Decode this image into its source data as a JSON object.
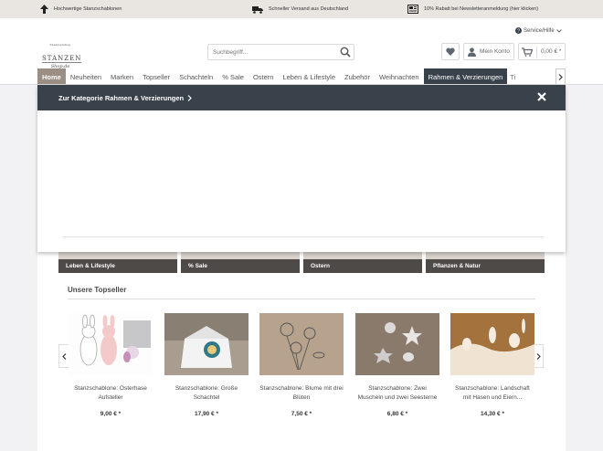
{
  "usp": [
    {
      "icon": "arrow-up-icon",
      "text": "Hochwertige Stanzschablonen"
    },
    {
      "icon": "truck-icon",
      "text": "Schneller Versand aus Deutschland"
    },
    {
      "icon": "newsletter-icon",
      "text": "10% Rabatt bei Newsletteranmeldung (hier klicken)"
    }
  ],
  "logo": {
    "line1": "Stempelshop",
    "line2": "STANZEN",
    "line3": "Shop.de"
  },
  "service": {
    "label": "Service/Hilfe"
  },
  "search": {
    "placeholder": "Suchbegriff..."
  },
  "account": {
    "label": "Mein Konto"
  },
  "cart": {
    "amount": "0,00 € *"
  },
  "nav": {
    "items": [
      "Home",
      "Neuheiten",
      "Marken",
      "Topseller",
      "Schachteln",
      "% Sale",
      "Ostern",
      "Leben & Lifestyle",
      "Zubehör",
      "Weihnachten",
      "Rahmen & Verzierungen",
      "Ti"
    ]
  },
  "flyout": {
    "link": "Zur Kategorie Rahmen & Verzierungen"
  },
  "categories": [
    "Leben & Lifestyle",
    "% Sale",
    "Ostern",
    "Pflanzen & Natur"
  ],
  "topseller": {
    "title": "Unsere Topseller",
    "products": [
      {
        "name": "Stanzschablone: Osterhase Aufsteller",
        "price": "9,00 € *"
      },
      {
        "name": "Stanzschablone: Große Schachtel",
        "price": "17,90 € *"
      },
      {
        "name": "Stanzschablone: Blume mit drei Blüten",
        "price": "7,50 € *"
      },
      {
        "name": "Stanzschablone: Zwei Muscheln und zwei Seesterne",
        "price": "6,80 € *"
      },
      {
        "name": "Stanzschablone: Landschaft mit Hasen und Eiern...",
        "price": "14,30 € *"
      }
    ]
  },
  "colors": {
    "nav_active": "#39424b",
    "home_tab": "#9a8e85",
    "topbar": "#e9e6e1"
  }
}
